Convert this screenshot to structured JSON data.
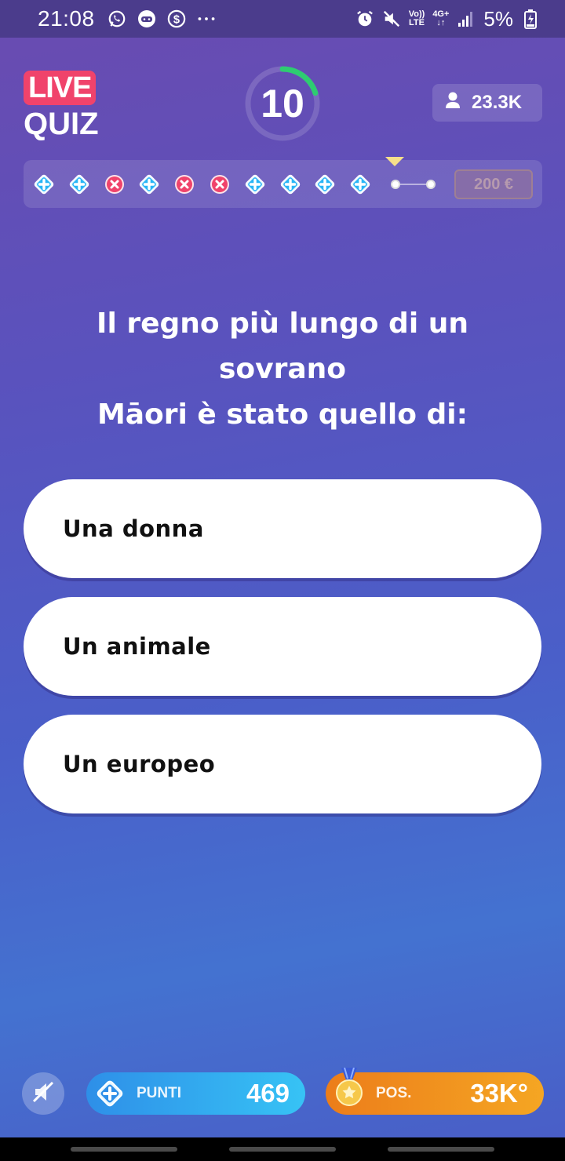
{
  "status_bar": {
    "time": "21:08",
    "left_icons": [
      "whatsapp-icon",
      "game-icon",
      "dollar-icon",
      "more-dots-icon"
    ],
    "volte_top": "Vo))",
    "volte_bottom": "LTE",
    "network": "4G+",
    "battery": "5%"
  },
  "logo": {
    "live": "LIVE",
    "quiz": "QUIZ"
  },
  "timer": {
    "value": "10",
    "remaining_fraction": 0.2,
    "accent": "#2ecc71"
  },
  "viewers": {
    "count": "23.3K",
    "icon": "user-icon"
  },
  "progress": {
    "steps": [
      "correct",
      "correct",
      "wrong",
      "correct",
      "wrong",
      "wrong",
      "correct",
      "correct",
      "correct",
      "correct",
      "pending",
      "pending"
    ],
    "current_index": 10,
    "prize": "200 €",
    "colors": {
      "correct": "#29b6f6",
      "wrong": "#f0436b",
      "marker": "#f7e08a"
    }
  },
  "question": {
    "line1": "Il regno più lungo di un sovrano",
    "line2": "Māori è stato quello di:"
  },
  "answers": [
    {
      "label": "Una donna"
    },
    {
      "label": "Un animale"
    },
    {
      "label": "Un europeo"
    }
  ],
  "bottom": {
    "mute_icon": "sound-off-icon",
    "points_label": "PUNTI",
    "points_value": "469",
    "position_label": "POS.",
    "position_value": "33K°"
  }
}
